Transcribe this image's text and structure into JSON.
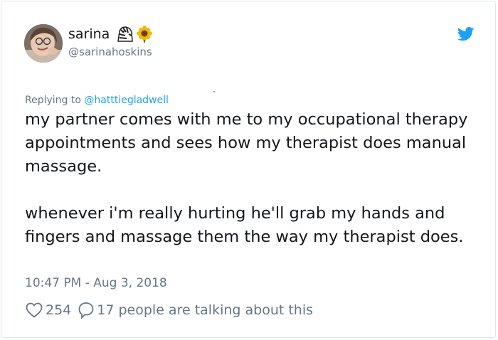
{
  "user": {
    "display_name": "sarina",
    "handle": "@sarinahoskins",
    "name_emojis": [
      "zebra-icon",
      "sunflower-icon"
    ]
  },
  "brand": {
    "icon": "twitter-bird-icon",
    "color": "#1da1f2"
  },
  "reply": {
    "prefix": "Replying to ",
    "to": "@hatttiegladwell"
  },
  "tweet": {
    "text": "my partner comes with me to my occupational therapy appointments and sees how my therapist does manual massage.\n\nwhenever i'm really hurting he'll grab my hands and fingers and massage them the way my therapist does.",
    "timestamp": "10:47 PM - Aug 3, 2018"
  },
  "actions": {
    "likes": "254",
    "replies": "17 people are talking about this"
  },
  "colors": {
    "text": "#14171a",
    "muted": "#657786",
    "border": "#e1e8ed"
  }
}
